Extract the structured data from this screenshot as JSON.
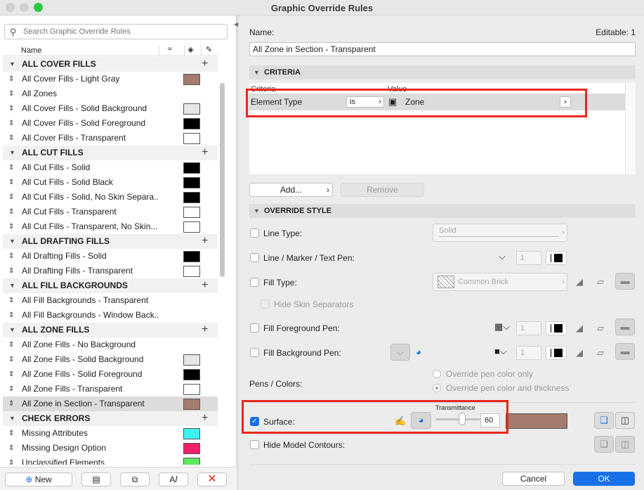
{
  "window": {
    "title": "Graphic Override Rules"
  },
  "search": {
    "placeholder": "Search Graphic Override Rules"
  },
  "columns": {
    "name": "Name"
  },
  "rows": [
    {
      "type": "group",
      "label": "ALL COVER FILLS"
    },
    {
      "type": "item",
      "label": "All Cover Fills - Light Gray",
      "swatch": "#a47b6d"
    },
    {
      "type": "item",
      "label": "All Zones",
      "swatch": null
    },
    {
      "type": "item",
      "label": "All Cover Fills - Solid Background",
      "swatch": "#e6e6e6"
    },
    {
      "type": "item",
      "label": "All Cover Fills - Solid Foreground",
      "swatch": "#000000"
    },
    {
      "type": "item",
      "label": "All Cover Fills - Transparent",
      "swatch": "#ffffff"
    },
    {
      "type": "group",
      "label": "ALL CUT FILLS"
    },
    {
      "type": "item",
      "label": "All Cut Fills - Solid",
      "swatch": "#000000"
    },
    {
      "type": "item",
      "label": "All Cut Fills - Solid Black",
      "swatch": "#000000"
    },
    {
      "type": "item",
      "label": "All Cut Fills - Solid, No Skin Separa...",
      "swatch": "#000000"
    },
    {
      "type": "item",
      "label": "All Cut Fills - Transparent",
      "swatch": "#ffffff"
    },
    {
      "type": "item",
      "label": "All Cut Fills - Transparent, No Skin...",
      "swatch": "#ffffff"
    },
    {
      "type": "group",
      "label": "ALL DRAFTING FILLS"
    },
    {
      "type": "item",
      "label": "All Drafting Fills - Solid",
      "swatch": "#000000"
    },
    {
      "type": "item",
      "label": "All Drafting Fills - Transparent",
      "swatch": "#ffffff"
    },
    {
      "type": "group",
      "label": "ALL FILL BACKGROUNDS"
    },
    {
      "type": "item",
      "label": "All Fill Backgrounds - Transparent",
      "swatch": null
    },
    {
      "type": "item",
      "label": "All Fill Backgrounds - Window Back...",
      "swatch": null
    },
    {
      "type": "group",
      "label": "ALL ZONE FILLS"
    },
    {
      "type": "item",
      "label": "All Zone Fills - No Background",
      "swatch": null
    },
    {
      "type": "item",
      "label": "All Zone Fills - Solid Background",
      "swatch": "#e6e6e6"
    },
    {
      "type": "item",
      "label": "All Zone Fills - Solid Foreground",
      "swatch": "#000000"
    },
    {
      "type": "item",
      "label": "All Zone Fills - Transparent",
      "swatch": "#ffffff"
    },
    {
      "type": "item",
      "label": "All Zone in Section - Transparent",
      "swatch": "#a47b6d",
      "selected": true
    },
    {
      "type": "group",
      "label": "CHECK ERRORS"
    },
    {
      "type": "item",
      "label": "Missing Attributes",
      "swatch": "#3df2f2"
    },
    {
      "type": "item",
      "label": "Missing Design Option",
      "swatch": "#f01f6c"
    },
    {
      "type": "item",
      "label": "Unclassified Elements",
      "swatch": "#5ee85e"
    }
  ],
  "bottom": {
    "new_label": "New",
    "new_icon": "plus-circle-icon",
    "rename_icon": "text-cursor-icon",
    "delete_icon": "red-x-icon"
  },
  "detail": {
    "name_label": "Name:",
    "editable": "Editable: 1",
    "name_value": "All Zone in Section - Transparent",
    "criteria_title": "CRITERIA",
    "criteria_col_criteria": "Criteria",
    "criteria_col_value": "Value",
    "criteria_row": {
      "element": "Element Type",
      "operator": "is",
      "value": "Zone",
      "value_icon": "zone-icon"
    },
    "add_label": "Add...",
    "remove_label": "Remove",
    "override_title": "OVERRIDE STYLE",
    "line_type_label": "Line Type:",
    "line_type_value": "Solid",
    "line_pen_label": "Line / Marker / Text Pen:",
    "line_pen_value": "1",
    "fill_type_label": "Fill Type:",
    "fill_type_value": "Common Brick",
    "hide_skin_label": "Hide Skin Separators",
    "fill_fg_label": "Fill Foreground Pen:",
    "fill_fg_value": "1",
    "fill_bg_label": "Fill Background Pen:",
    "fill_bg_value": "1",
    "pens_colors_label": "Pens / Colors:",
    "radio_color_only": "Override pen color only",
    "radio_color_thickness": "Override pen color and thickness",
    "surface_label": "Surface:",
    "transmittance_label": "Transmittance",
    "transmittance_value": "60",
    "surface_color": "#a47b6d",
    "hide_contours_label": "Hide Model Contours:",
    "cancel_label": "Cancel",
    "ok_label": "OK"
  },
  "colors": {
    "accent": "#1870e8",
    "highlight": "#e8291c"
  }
}
